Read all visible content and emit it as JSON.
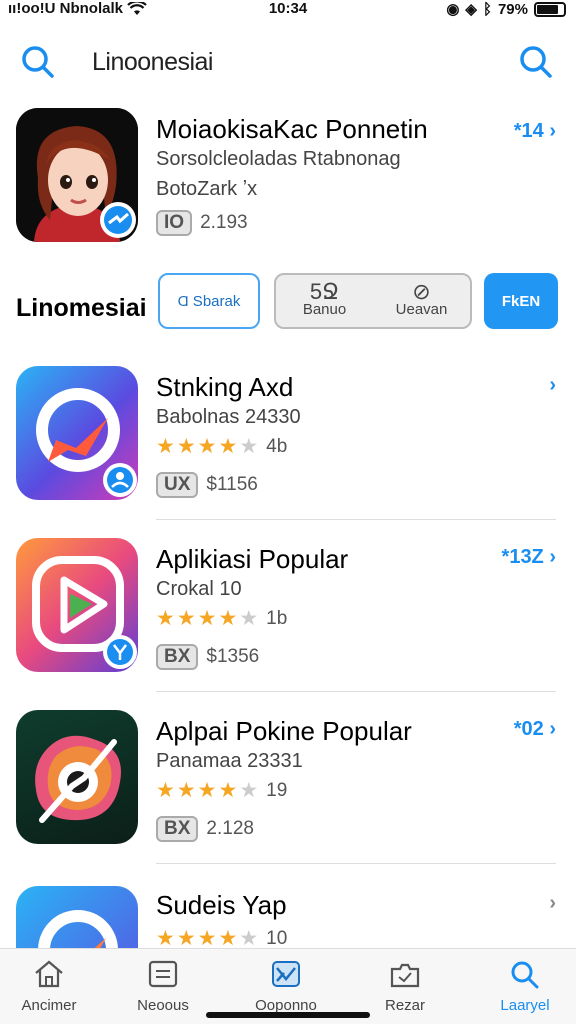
{
  "status_bar": {
    "carrier": "ıı!oo!U Nbnolalk",
    "time": "10:34",
    "battery": "79%",
    "battery_level": 0.79
  },
  "search": {
    "query": "Linoonesiai"
  },
  "featured": {
    "title": "MoiaokisaKac Ponnetin",
    "subtitle": "Sorsolcleoladas Rtabnonag",
    "developer": "BotoZark ʼx",
    "tag": "IO",
    "meta": "2.193",
    "price": "*14 ›"
  },
  "section": {
    "title": "Linomesiai",
    "chip1": "Ɑ Ѕbarak",
    "chip2_left_top": "5Ջ",
    "chip2_left_bottom": "Banuo",
    "chip2_right_bottom": "Ueavan",
    "chip3": "FkEN"
  },
  "apps": [
    {
      "title": "Stnkinɡ Axd",
      "subtitle": "Babolnas 24330",
      "rating": 4,
      "rating_count": "4b",
      "tag": "UX",
      "meta": "$1156",
      "price": "›"
    },
    {
      "title": "Aplikiasi Popular",
      "subtitle": "Crokal 10",
      "rating": 4,
      "rating_count": "1b",
      "tag": "BX",
      "meta": "$1356",
      "price": "*13Z ›"
    },
    {
      "title": "Aplpai Pokine Popular",
      "subtitle": "Panamaa 23331",
      "rating": 4,
      "rating_count": "19",
      "tag": "BX",
      "meta": "2.128",
      "price": "*02 ›"
    },
    {
      "title": "Sudeis Yap",
      "subtitle": "",
      "rating": 4,
      "rating_count": "10",
      "tag": "",
      "meta": "",
      "price": "›"
    }
  ],
  "tabs": [
    {
      "label": "Ancimer",
      "icon": "home-icon"
    },
    {
      "label": "Neoous",
      "icon": "news-icon"
    },
    {
      "label": "Ooponno",
      "icon": "apps-icon"
    },
    {
      "label": "Rezar",
      "icon": "tray-icon"
    },
    {
      "label": "Laaryel",
      "icon": "search-icon"
    }
  ],
  "colors": {
    "accent": "#1a8ef0",
    "star": "#f5a623"
  }
}
